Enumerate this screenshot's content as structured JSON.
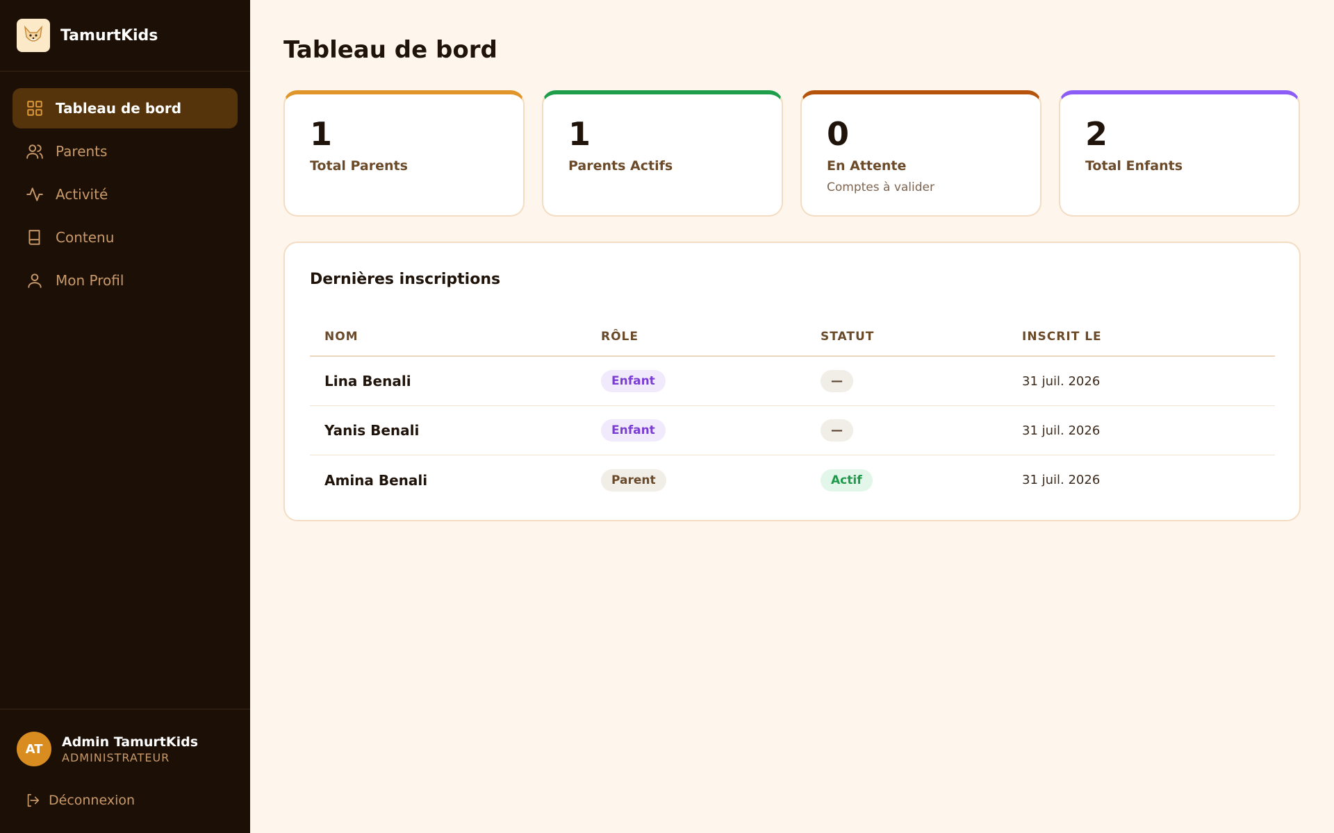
{
  "app": {
    "name": "TamurtKids",
    "logo_icon": "fox-logo-icon"
  },
  "sidebar": {
    "items": [
      {
        "label": "Tableau de bord",
        "icon": "grid-icon",
        "active": true
      },
      {
        "label": "Parents",
        "icon": "users-icon",
        "active": false
      },
      {
        "label": "Activité",
        "icon": "activity-icon",
        "active": false
      },
      {
        "label": "Contenu",
        "icon": "book-icon",
        "active": false
      },
      {
        "label": "Mon Profil",
        "icon": "user-icon",
        "active": false
      }
    ],
    "user": {
      "initials": "AT",
      "name": "Admin TamurtKids",
      "role": "ADMINISTRATEUR"
    },
    "logout_label": "Déconnexion"
  },
  "page": {
    "title": "Tableau de bord"
  },
  "stats": [
    {
      "value": "1",
      "label": "Total Parents",
      "sub": "",
      "accent": "#e0952a"
    },
    {
      "value": "1",
      "label": "Parents Actifs",
      "sub": "",
      "accent": "#1e9e4a"
    },
    {
      "value": "0",
      "label": "En Attente",
      "sub": "Comptes à valider",
      "accent": "#b45309"
    },
    {
      "value": "2",
      "label": "Total Enfants",
      "sub": "",
      "accent": "#8b5cf6"
    }
  ],
  "registrations": {
    "title": "Dernières inscriptions",
    "columns": [
      "NOM",
      "RÔLE",
      "STATUT",
      "INSCRIT LE"
    ],
    "rows": [
      {
        "name": "Lina Benali",
        "role": "Enfant",
        "status": "—",
        "date": "31 juil. 2026"
      },
      {
        "name": "Yanis Benali",
        "role": "Enfant",
        "status": "—",
        "date": "31 juil. 2026"
      },
      {
        "name": "Amina Benali",
        "role": "Parent",
        "status": "Actif",
        "date": "31 juil. 2026"
      }
    ]
  }
}
